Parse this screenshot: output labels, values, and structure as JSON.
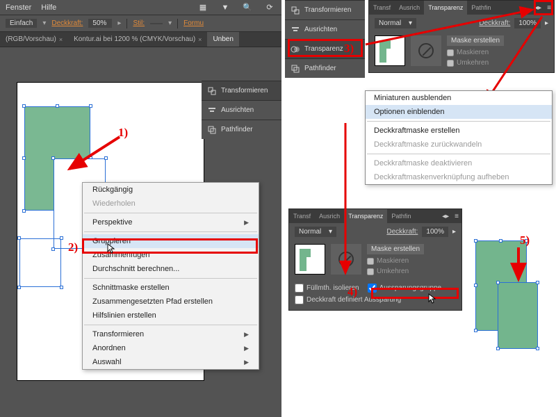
{
  "menubar": {
    "fenster": "Fenster",
    "hilfe": "Hilfe"
  },
  "toolbar": {
    "einfach_label": "Einfach",
    "deckkraft_label": "Deckkraft:",
    "deckkraft_value": "50%",
    "stil_label": "Stil:",
    "formular": "Formu"
  },
  "doctabs": {
    "tab1": "(RGB/Vorschau)",
    "tab2": "Kontur.ai bei 1200 % (CMYK/Vorschau)",
    "tab3": "Unben"
  },
  "panel_items": {
    "transformieren": "Transformieren",
    "ausrichten": "Ausrichten",
    "transparenz": "Transparenz",
    "pathfinder": "Pathfinder"
  },
  "panel_tabs": {
    "transf": "Transf",
    "ausrich": "Ausrich",
    "transparenz": "Transparenz",
    "pathfin": "Pathfin"
  },
  "transparenz_panel": {
    "mode": "Normal",
    "deckkraft_label": "Deckkraft:",
    "deckkraft_value": "100%",
    "maske_erstellen": "Maske erstellen",
    "maskieren": "Maskieren",
    "umkehren": "Umkehren",
    "fullmth": "Füllmth. isolieren",
    "aussparung": "Aussparungsgruppe",
    "deckkraft_def": "Deckkraft definiert Aussparung"
  },
  "ctx": {
    "ruckgangig": "Rückgängig",
    "wiederholen": "Wiederholen",
    "perspektive": "Perspektive",
    "gruppieren": "Gruppieren",
    "zusammenfugen": "Zusammenfügen",
    "durchschnitt": "Durchschnitt berechnen...",
    "schnittmaske": "Schnittmaske erstellen",
    "pfad": "Zusammengesetzten Pfad erstellen",
    "hilfslinien": "Hilfslinien erstellen",
    "transformieren": "Transformieren",
    "anordnen": "Anordnen",
    "auswahl": "Auswahl"
  },
  "fly": {
    "miniaturen": "Miniaturen ausblenden",
    "optionen": "Optionen einblenden",
    "maske_erstellen": "Deckkraftmaske erstellen",
    "maske_zuruck": "Deckkraftmaske zurückwandeln",
    "maske_deakt": "Deckkraftmaske deaktivieren",
    "maske_verkn": "Deckkraftmaskenverknüpfung aufheben"
  },
  "callouts": {
    "c1": "1)",
    "c2": "2)",
    "c3": "3)",
    "c4": "4)",
    "c5": "5)"
  }
}
